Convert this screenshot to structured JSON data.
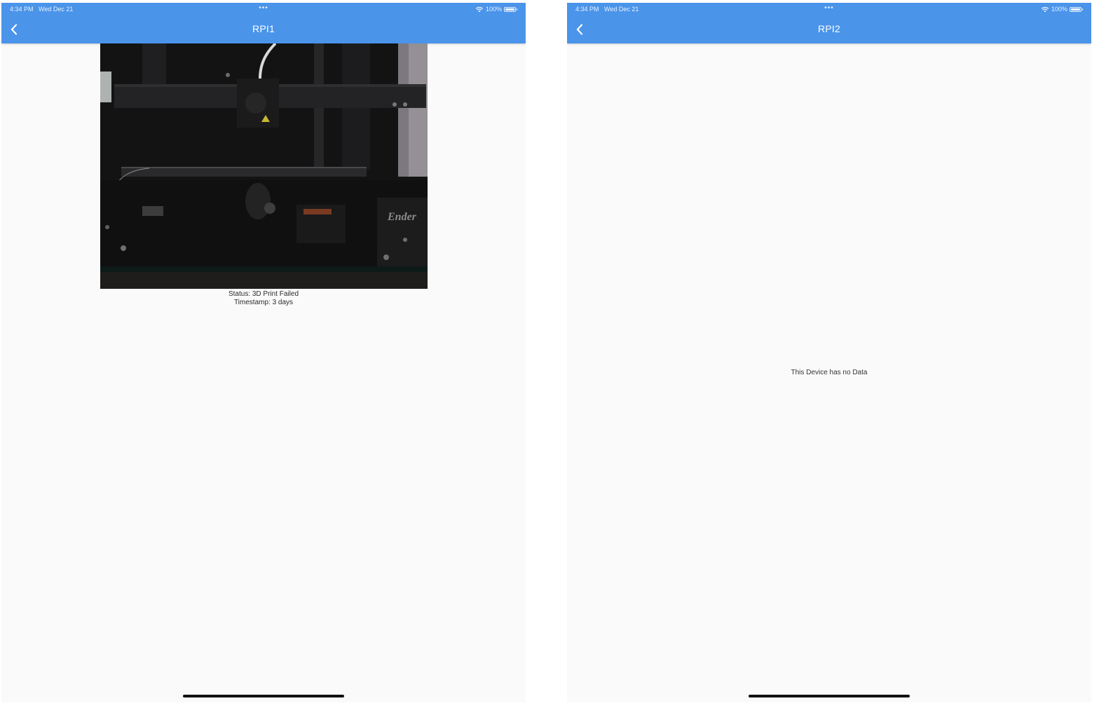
{
  "colors": {
    "appbar": "#4a94ea",
    "background": "#fafafa",
    "text": "#2a2a2a"
  },
  "screens": [
    {
      "status_bar": {
        "time": "4:34 PM",
        "date": "Wed Dec 21",
        "dots": "•••",
        "battery": "100%"
      },
      "title": "RPI1",
      "back_icon": "chevron-left-icon",
      "image": {
        "watermark": "Ender"
      },
      "status_text": "Status: 3D Print Failed",
      "timestamp_text": "Timestamp: 3 days"
    },
    {
      "status_bar": {
        "time": "4:34 PM",
        "date": "Wed Dec 21",
        "dots": "•••",
        "battery": "100%"
      },
      "title": "RPI2",
      "back_icon": "chevron-left-icon",
      "empty_message": "This Device has no Data"
    }
  ]
}
